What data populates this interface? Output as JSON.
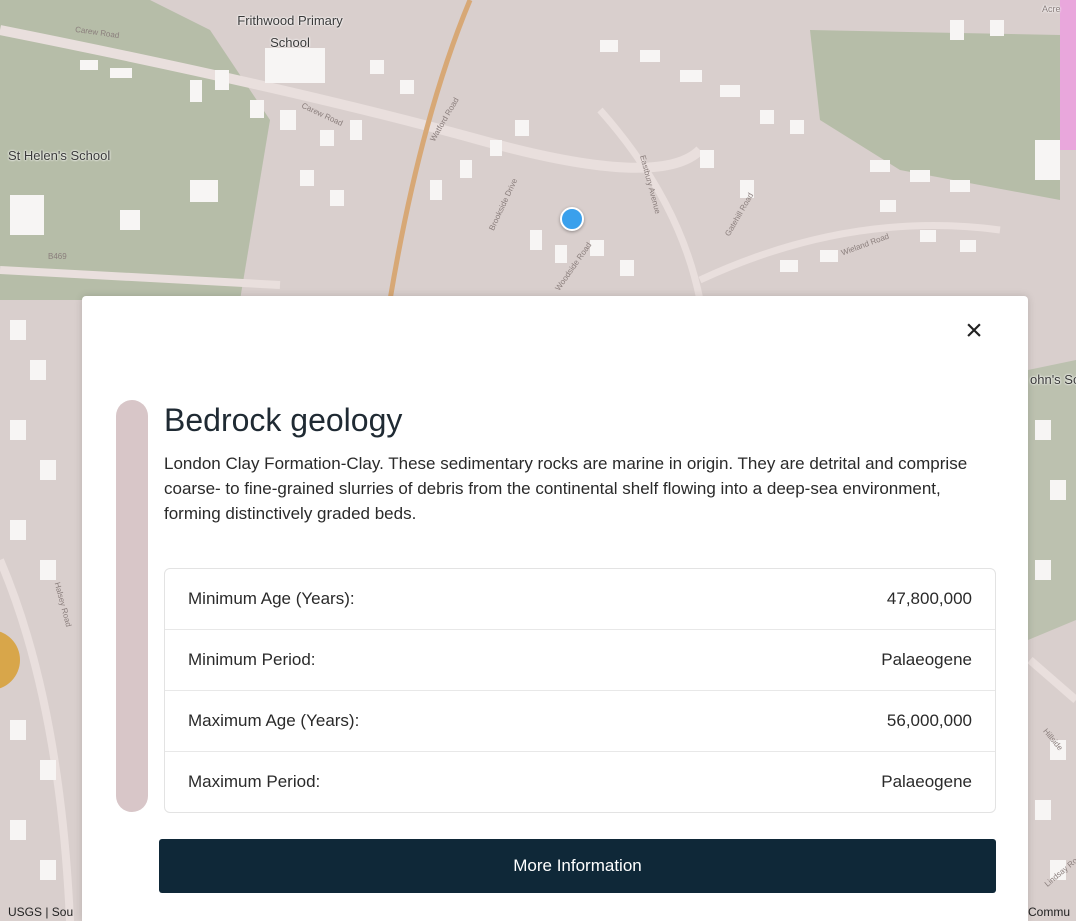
{
  "map": {
    "labels": {
      "school_1": "Frithwood Primary\nSchool",
      "school_2": "St Helen's School",
      "school_3_partial": "ohn's Sc",
      "attribution_left": "USGS | Sou",
      "attribution_right": "Commu",
      "top_right_partial": "Acre"
    },
    "roads": [
      "Carew Road",
      "Carew Road",
      "Watford Road",
      "Brookside Drive",
      "Woodside Road",
      "Eastbury Avenue",
      "Gatehill Road",
      "Wieland Road",
      "B469",
      "Hillside",
      "Halsey Road",
      "Lindsay Road"
    ]
  },
  "card": {
    "close_label": "×",
    "title": "Bedrock geology",
    "description": "London Clay Formation-Clay. These sedimentary rocks are marine in origin. They are detrital and comprise coarse- to fine-grained slurries of debris from the continental shelf flowing into a deep-sea environment, forming distinctively graded beds.",
    "properties": [
      {
        "label": "Minimum Age (Years):",
        "value": "47,800,000"
      },
      {
        "label": "Minimum Period:",
        "value": "Palaeogene"
      },
      {
        "label": "Maximum Age (Years):",
        "value": "56,000,000"
      },
      {
        "label": "Maximum Period:",
        "value": "Palaeogene"
      }
    ],
    "button_label": "More Information"
  },
  "colors": {
    "map_base": "#d9cfcd",
    "green_area": "#9cb08e",
    "building": "#f7f5f4",
    "location_dot": "#3aa0ec",
    "button_bg": "#0f2838",
    "accent_bar": "#d8c6c8"
  }
}
